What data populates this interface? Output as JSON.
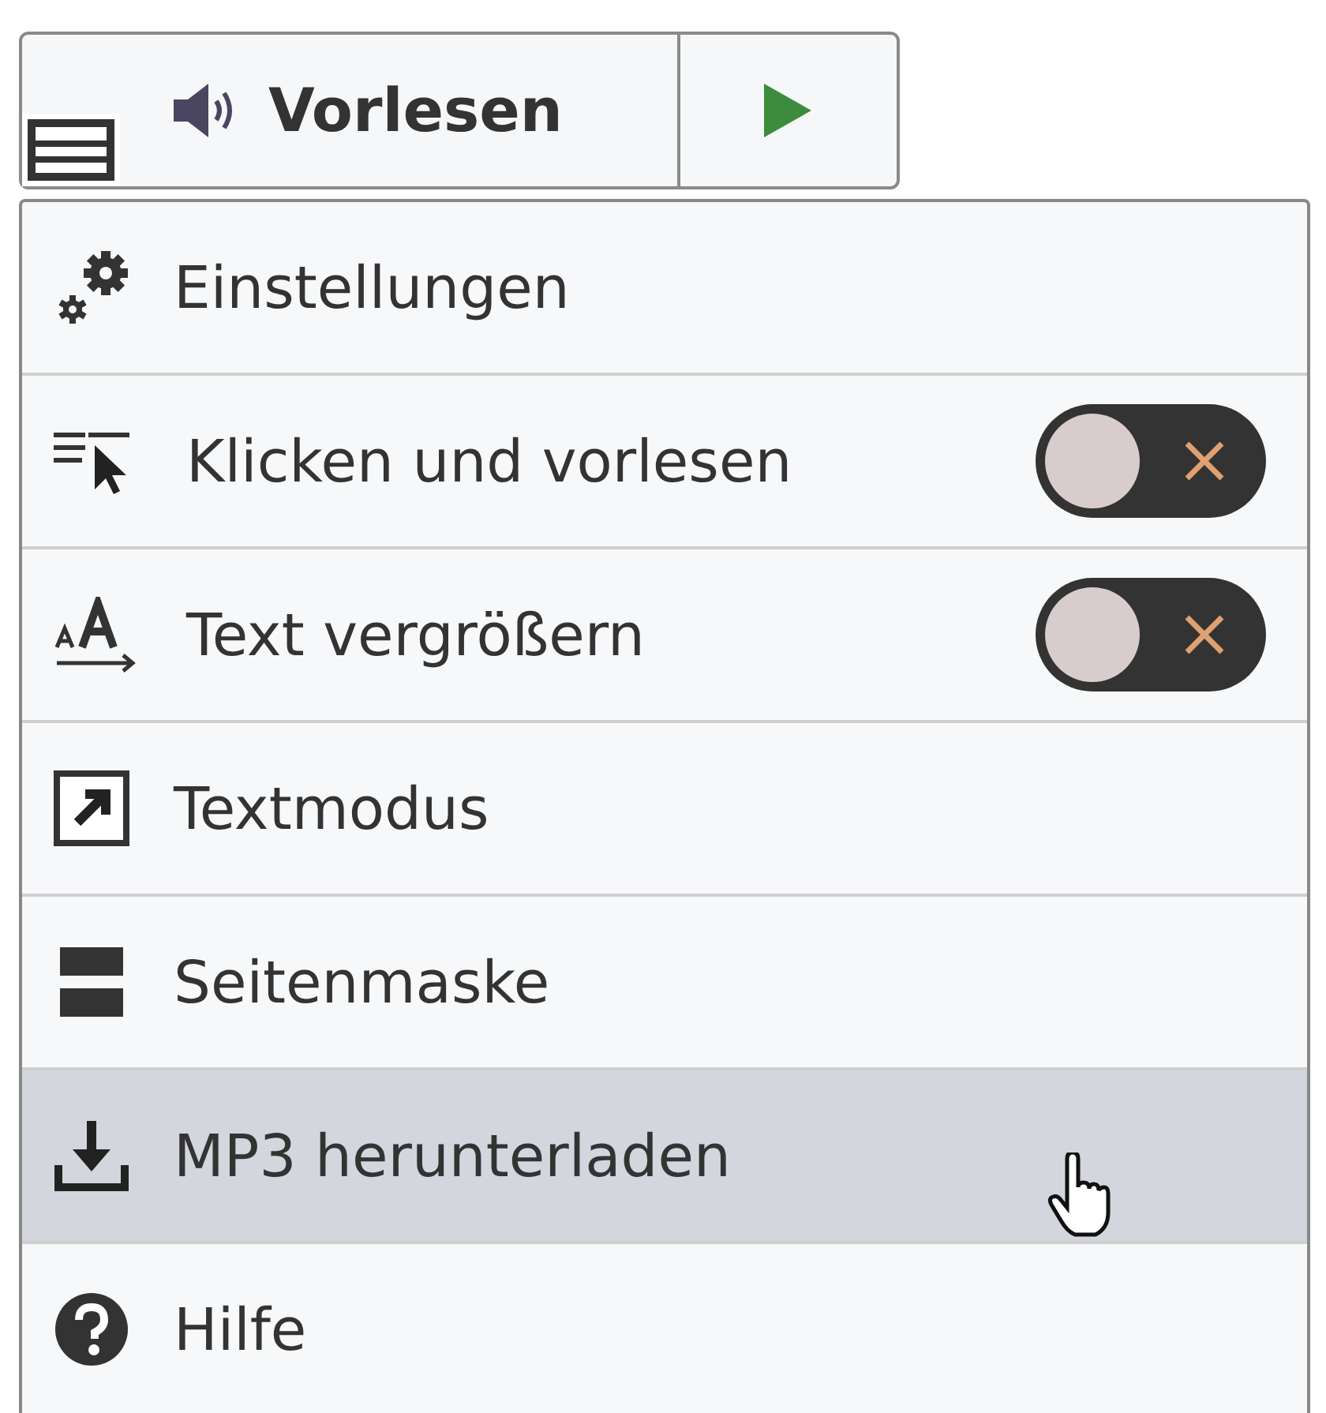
{
  "toolbar": {
    "read_button": "Vorlesen"
  },
  "menu": {
    "items": [
      {
        "label": "Einstellungen",
        "kind": "link",
        "hovered": false
      },
      {
        "label": "Klicken und vorlesen",
        "kind": "toggle",
        "on": false,
        "hovered": false
      },
      {
        "label": "Text vergrößern",
        "kind": "toggle",
        "on": false,
        "hovered": false
      },
      {
        "label": "Textmodus",
        "kind": "link",
        "hovered": false
      },
      {
        "label": "Seitenmaske",
        "kind": "link",
        "hovered": false
      },
      {
        "label": "MP3 herunterladen",
        "kind": "link",
        "hovered": true
      },
      {
        "label": "Hilfe",
        "kind": "link",
        "hovered": false
      }
    ]
  }
}
